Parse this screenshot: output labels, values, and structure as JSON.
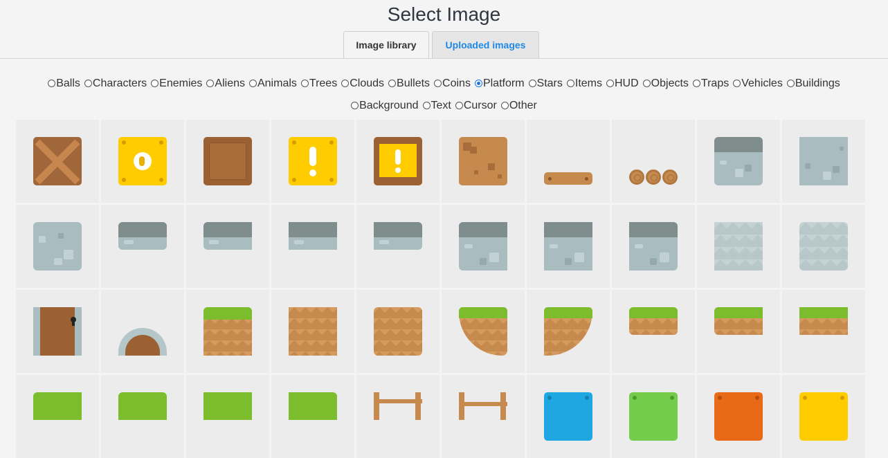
{
  "title": "Select Image",
  "tabs": {
    "library": "Image library",
    "uploaded": "Uploaded images"
  },
  "categories_row1": [
    "Balls",
    "Characters",
    "Enemies",
    "Aliens",
    "Animals",
    "Trees",
    "Clouds",
    "Bullets",
    "Coins",
    "Platform",
    "Stars",
    "Items",
    "HUD",
    "Objects",
    "Traps",
    "Vehicles",
    "Buildings"
  ],
  "categories_row2": [
    "Background",
    "Text",
    "Cursor",
    "Other"
  ],
  "selected_category": "Platform",
  "sprites": [
    "crate",
    "yellow-coin-block",
    "brown-block",
    "exclamation-block",
    "exclamation-framed-block",
    "dirt-block",
    "wood-plank",
    "log-stack",
    "stone-block-top",
    "stone-block",
    "stone-block-rounded",
    "stone-platform-rounded",
    "stone-platform-left",
    "stone-platform-mid",
    "stone-platform-right",
    "stone-top-left",
    "stone-top-mid",
    "stone-top-right",
    "stone-zigzag",
    "stone-zigzag-rounded",
    "door",
    "arch-door",
    "grass-block",
    "dirt-zigzag",
    "dirt-zigzag-rounded",
    "grass-curve-left",
    "grass-curve-right",
    "grass-platform-rounded",
    "grass-platform-mid",
    "grass-platform-right",
    "grass-row4-1",
    "grass-row4-2",
    "grass-row4-3",
    "grass-row4-4",
    "fence-left",
    "fence-right",
    "blue-block",
    "green-block",
    "orange-block",
    "yellow-block"
  ],
  "colors": {
    "accent": "#1a73e8",
    "brown": "#9c6132",
    "yellow": "#ffcc00",
    "grass": "#7bbd2d",
    "stone": "#a9bcbf"
  }
}
